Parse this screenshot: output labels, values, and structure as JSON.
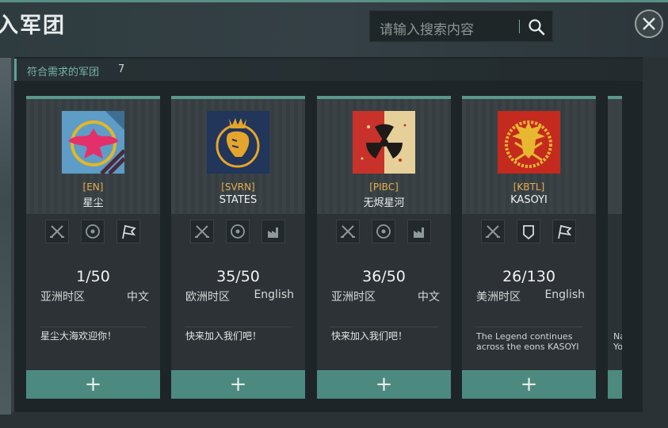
{
  "header": {
    "title": "入军团",
    "search_placeholder": "请输入搜索内容"
  },
  "section": {
    "label": "符合需求的军团",
    "count": "7"
  },
  "cards": [
    {
      "tag": "[EN]",
      "name": "星尘",
      "members": "1/50",
      "timezone": "亚洲时区",
      "language": "中文",
      "description": "星尘大海欢迎你！",
      "join": "+"
    },
    {
      "tag": "[SVRN]",
      "name": "STATES",
      "members": "35/50",
      "timezone": "欧洲时区",
      "language": "English",
      "description": "快来加入我们吧！",
      "join": "+"
    },
    {
      "tag": "[PIBC]",
      "name": "无烬星河",
      "members": "36/50",
      "timezone": "亚洲时区",
      "language": "中文",
      "description": "快来加入我们吧！",
      "join": "+"
    },
    {
      "tag": "[KBTL]",
      "name": "KASOYI",
      "members": "26/130",
      "timezone": "美洲时区",
      "language": "English",
      "description_line1": "The Legend continues",
      "description_line2": "across the eons     KASOYI",
      "join": "+"
    }
  ],
  "partial_card": {
    "desc_line1": "Na",
    "desc_line2": "Yo"
  },
  "colors": {
    "accent": "#5a978c",
    "tag": "#e6ae4e",
    "join_bg": "#4c8a7f"
  }
}
